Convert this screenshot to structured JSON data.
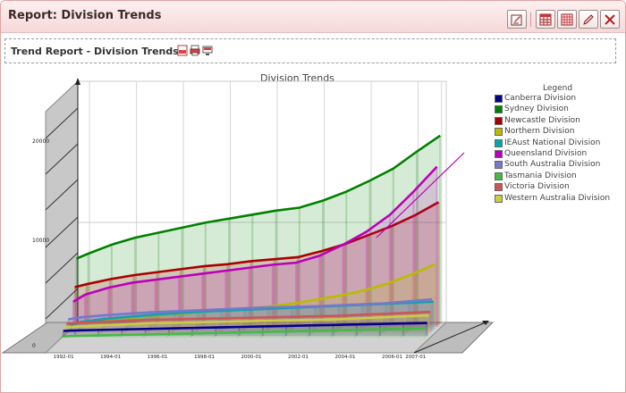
{
  "window": {
    "title": "Report: Division Trends",
    "tools": [
      {
        "icon": "edit-report-icon"
      },
      {
        "icon": "table-icon"
      },
      {
        "icon": "grid-icon"
      },
      {
        "icon": "pencil-icon"
      },
      {
        "icon": "close-icon"
      }
    ]
  },
  "report": {
    "subtitle": "Trend Report - Division Trends",
    "export_icons": [
      "pdf-icon",
      "print-icon",
      "export-icon"
    ]
  },
  "chart_data": {
    "type": "area",
    "title": "Division Trends",
    "legend_title": "Legend",
    "legend_position": "right",
    "grid": true,
    "ylim": [
      0,
      20000
    ],
    "y_ticks": [
      "0",
      "10000",
      "20000"
    ],
    "x_ticks": [
      "1992-01",
      "1994-01",
      "1996-01",
      "1998-01",
      "2000-01",
      "2002-01",
      "2004-01",
      "2006-01",
      "2007-01"
    ],
    "x": [
      1991.5,
      1992,
      1993,
      1994,
      1995,
      1996,
      1997,
      1998,
      1999,
      2000,
      2001,
      2002,
      2003,
      2004,
      2005,
      2006,
      2007
    ],
    "series": [
      {
        "name": "Canberra Division",
        "color": "#00008b",
        "values": [
          500,
          550,
          600,
          650,
          700,
          750,
          800,
          850,
          900,
          950,
          1000,
          1050,
          1100,
          1150,
          1200,
          1250,
          1300
        ]
      },
      {
        "name": "Sydney Division",
        "color": "#008000",
        "values": [
          6500,
          7000,
          7900,
          8600,
          9100,
          9600,
          10100,
          10500,
          10900,
          11300,
          11600,
          12300,
          13200,
          14300,
          15500,
          17200,
          18800
        ]
      },
      {
        "name": "Newcastle Division",
        "color": "#aa0000",
        "values": [
          3800,
          4100,
          4600,
          5000,
          5300,
          5600,
          5900,
          6100,
          6400,
          6600,
          6800,
          7400,
          8100,
          9000,
          9900,
          11000,
          12300
        ]
      },
      {
        "name": "Northern Division",
        "color": "#bbbb00",
        "values": [
          400,
          600,
          800,
          1000,
          1200,
          1400,
          1600,
          1800,
          2000,
          2200,
          2500,
          2900,
          3300,
          3800,
          4500,
          5400,
          6400
        ]
      },
      {
        "name": "IEAust National Division",
        "color": "#00aaaa",
        "values": [
          400,
          800,
          1100,
          1300,
          1500,
          1650,
          1800,
          1900,
          2000,
          2100,
          2200,
          2300,
          2400,
          2500,
          2600,
          2700,
          2800
        ]
      },
      {
        "name": "Queensland Division",
        "color": "#bb00bb",
        "values": [
          2500,
          3200,
          3900,
          4400,
          4700,
          5000,
          5300,
          5600,
          5900,
          6200,
          6400,
          7100,
          8200,
          9500,
          11200,
          13500,
          16000
        ]
      },
      {
        "name": "South Australia Division",
        "color": "#7777cc",
        "values": [
          1200,
          1400,
          1600,
          1750,
          1900,
          2000,
          2100,
          2200,
          2300,
          2400,
          2450,
          2500,
          2600,
          2700,
          2800,
          3000,
          3200
        ]
      },
      {
        "name": "Tasmania Division",
        "color": "#44bb44",
        "values": [
          100,
          150,
          200,
          250,
          300,
          350,
          400,
          450,
          500,
          550,
          600,
          650,
          700,
          750,
          800,
          850,
          900
        ]
      },
      {
        "name": "Victoria Division",
        "color": "#cc5555",
        "values": [
          900,
          1000,
          1100,
          1200,
          1300,
          1350,
          1400,
          1450,
          1500,
          1550,
          1600,
          1650,
          1700,
          1800,
          1900,
          2000,
          2100
        ]
      },
      {
        "name": "Western Australia Division",
        "color": "#cccc44",
        "values": [
          700,
          800,
          900,
          1000,
          1100,
          1150,
          1200,
          1250,
          1300,
          1350,
          1400,
          1450,
          1500,
          1600,
          1700,
          1800,
          1900
        ]
      }
    ]
  }
}
